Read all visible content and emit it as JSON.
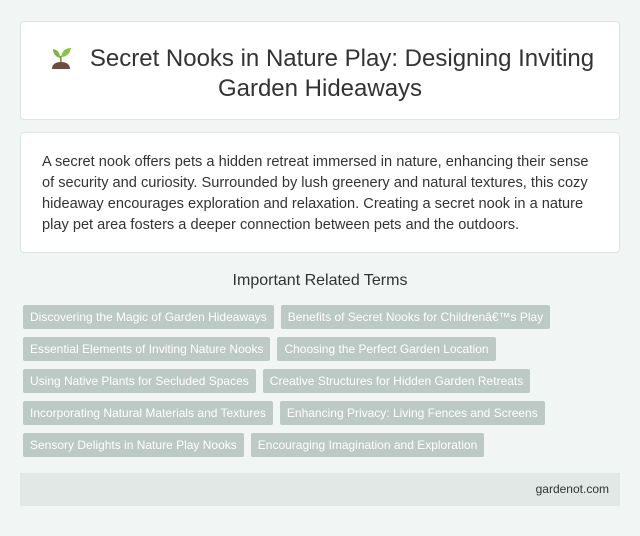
{
  "header": {
    "icon": "seedling-icon",
    "title": "Secret Nooks in Nature Play: Designing Inviting Garden Hideaways"
  },
  "summary": {
    "text": "A secret nook offers pets a hidden retreat immersed in nature, enhancing their sense of security and curiosity. Surrounded by lush greenery and natural textures, this cozy hideaway encourages exploration and relaxation. Creating a secret nook in a nature play pet area fosters a deeper connection between pets and the outdoors."
  },
  "related": {
    "heading": "Important Related Terms",
    "terms": [
      "Discovering the Magic of Garden Hideaways",
      "Benefits of Secret Nooks for Childrenâ€™s Play",
      "Essential Elements of Inviting Nature Nooks",
      "Choosing the Perfect Garden Location",
      "Using Native Plants for Secluded Spaces",
      "Creative Structures for Hidden Garden Retreats",
      "Incorporating Natural Materials and Textures",
      "Enhancing Privacy: Living Fences and Screens",
      "Sensory Delights in Nature Play Nooks",
      "Encouraging Imagination and Exploration"
    ]
  },
  "footer": {
    "site": "gardenot.com"
  },
  "colors": {
    "background": "#f1f5f3",
    "tag": "#bcc9c4",
    "footer": "#e1e8e5"
  }
}
